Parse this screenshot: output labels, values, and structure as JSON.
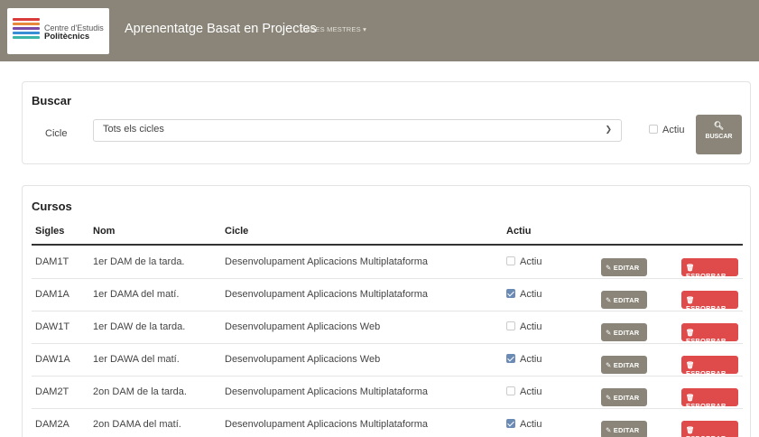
{
  "header": {
    "logo": {
      "line1": "Centre d'Estudis",
      "line2": "Politècnics",
      "bar_colors": [
        "#d93a3a",
        "#e6893a",
        "#7b4aa6",
        "#3a8ed6",
        "#3ab5a8"
      ]
    },
    "title": "Aprenentatge Basat en Projectes",
    "menu": "DADES MESTRES",
    "menu_icon": "caret-down-icon"
  },
  "search": {
    "title": "Buscar",
    "cicle_label": "Cicle",
    "cicle_value": "Tots els cicles",
    "actiu_label": "Actiu",
    "actiu_checked": false,
    "button_label": "BUSCAR",
    "button_icon": "search-icon"
  },
  "cursos": {
    "title": "Cursos",
    "columns": {
      "sigles": "Sigles",
      "nom": "Nom",
      "cicle": "Cicle",
      "actiu": "Actiu"
    },
    "edit_label": "EDITAR",
    "delete_label": "ESBORRAR",
    "rows": [
      {
        "sigles": "DAM1T",
        "nom": "1er DAM de la tarda.",
        "cicle": "Desenvolupament Aplicacions Multiplataforma",
        "actiu_label": "Actiu",
        "actiu": false
      },
      {
        "sigles": "DAM1A",
        "nom": "1er DAMA del matí.",
        "cicle": "Desenvolupament Aplicacions Multiplataforma",
        "actiu_label": "Actiu",
        "actiu": true
      },
      {
        "sigles": "DAW1T",
        "nom": "1er DAW de la tarda.",
        "cicle": "Desenvolupament Aplicacions Web",
        "actiu_label": "Actiu",
        "actiu": false
      },
      {
        "sigles": "DAW1A",
        "nom": "1er DAWA del matí.",
        "cicle": "Desenvolupament Aplicacions Web",
        "actiu_label": "Actiu",
        "actiu": true
      },
      {
        "sigles": "DAM2T",
        "nom": "2on DAM de la tarda.",
        "cicle": "Desenvolupament Aplicacions Multiplataforma",
        "actiu_label": "Actiu",
        "actiu": false
      },
      {
        "sigles": "DAM2A",
        "nom": "2on DAMA del matí.",
        "cicle": "Desenvolupament Aplicacions Multiplataforma",
        "actiu_label": "Actiu",
        "actiu": true
      }
    ]
  },
  "colors": {
    "navbar": "#8a8578",
    "danger": "#df4a4a",
    "checkbox": "#6b8bb5"
  }
}
